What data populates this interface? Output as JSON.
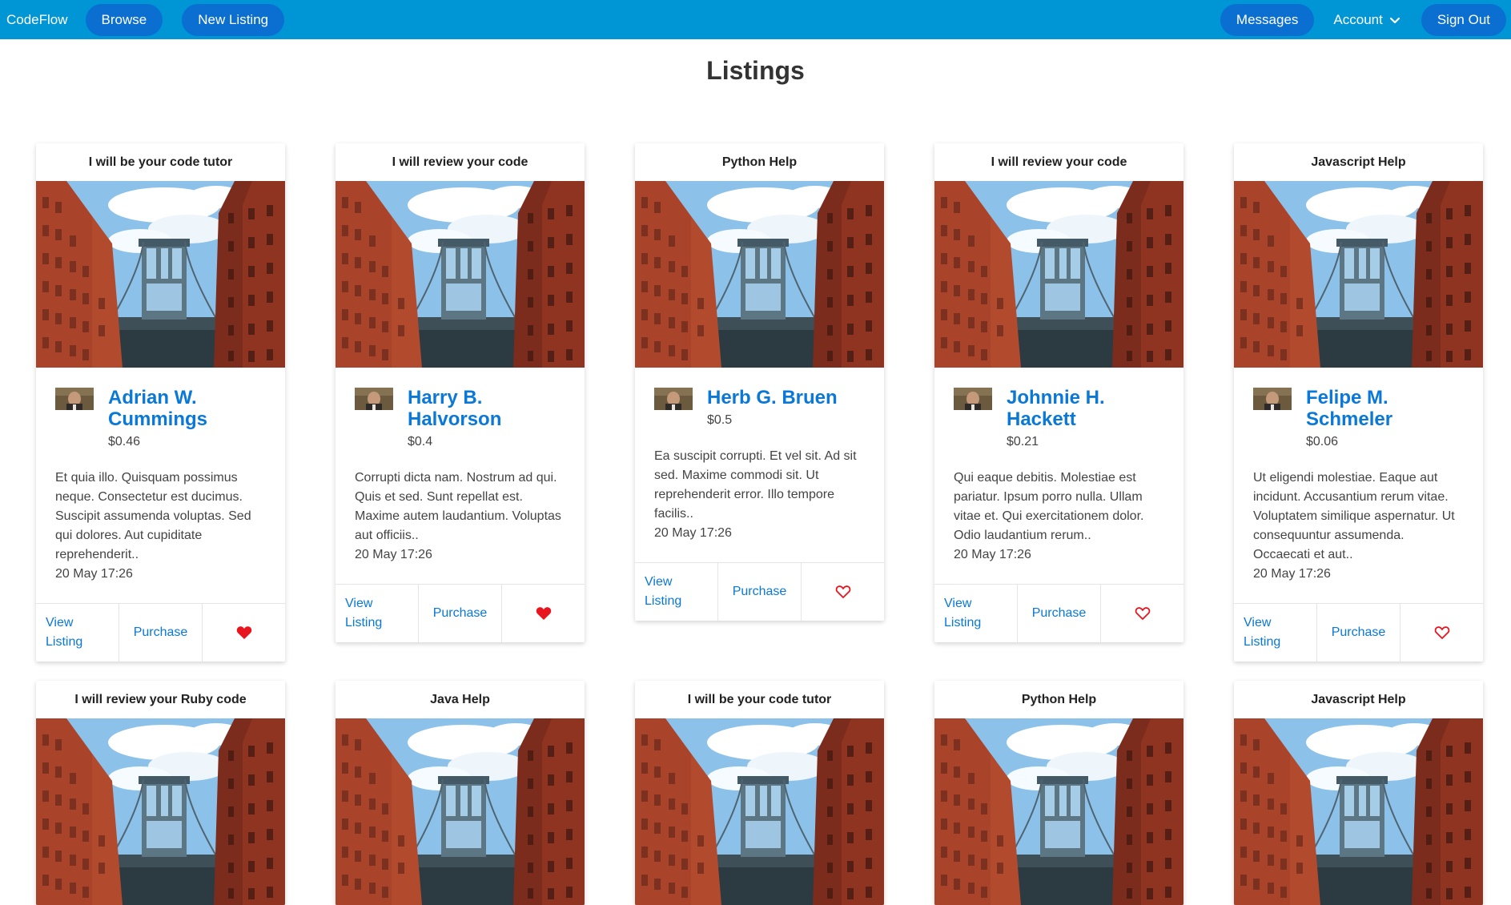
{
  "nav": {
    "brand": "CodeFlow",
    "browse": "Browse",
    "new_listing": "New Listing",
    "messages": "Messages",
    "account": "Account",
    "sign_out": "Sign Out",
    "bg_color": "#0096d6",
    "pill_color": "#0a6fd0"
  },
  "page": {
    "title": "Listings"
  },
  "actions": {
    "view": "View Listing",
    "purchase": "Purchase"
  },
  "listings": [
    {
      "title": "I will be your code tutor",
      "seller": "Adrian W. Cummings",
      "price": "$0.46",
      "description": "Et quia illo. Quisquam possimus neque. Consectetur est ducimus. Suscipit assumenda voluptas. Sed qui dolores. Aut cupiditate reprehenderit..",
      "date": "20 May 17:26",
      "favorited": true
    },
    {
      "title": "I will review your code",
      "seller": "Harry B. Halvorson",
      "price": "$0.4",
      "description": "Corrupti dicta nam. Nostrum ad qui. Quis et sed. Sunt repellat est. Maxime autem laudantium. Voluptas aut officiis..",
      "date": "20 May 17:26",
      "favorited": true
    },
    {
      "title": "Python Help",
      "seller": "Herb G. Bruen",
      "price": "$0.5",
      "description": "Ea suscipit corrupti. Et vel sit. Ad sit sed. Maxime commodi sit. Ut reprehenderit error. Illo tempore facilis..",
      "date": "20 May 17:26",
      "favorited": false
    },
    {
      "title": "I will review your code",
      "seller": "Johnnie H. Hackett",
      "price": "$0.21",
      "description": "Qui eaque debitis. Molestiae est pariatur. Ipsum porro nulla. Ullam vitae et. Qui exercitationem dolor. Odio laudantium rerum..",
      "date": "20 May 17:26",
      "favorited": false
    },
    {
      "title": "Javascript Help",
      "seller": "Felipe M. Schmeler",
      "price": "$0.06",
      "description": "Ut eligendi molestiae. Eaque aut incidunt. Accusantium rerum vitae. Voluptatem similique aspernatur. Ut consequuntur assumenda. Occaecati et aut..",
      "date": "20 May 17:26",
      "favorited": false
    },
    {
      "title": "I will review your Ruby code"
    },
    {
      "title": "Java Help"
    },
    {
      "title": "I will be your code tutor"
    },
    {
      "title": "Python Help"
    },
    {
      "title": "Javascript Help"
    }
  ],
  "colors": {
    "link": "#0a78d6",
    "heart": "#e8141e"
  }
}
